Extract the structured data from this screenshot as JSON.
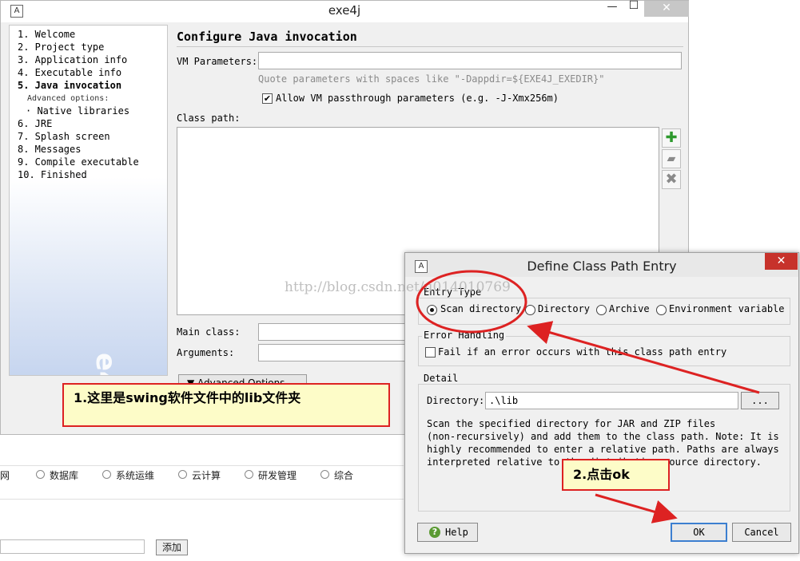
{
  "main_window": {
    "title": "exe4j",
    "icon_glyph": "A",
    "controls": {
      "minimize": "—",
      "maximize": "☐",
      "close": "✕"
    },
    "steps": [
      "1. Welcome",
      "2. Project type",
      "3. Application info",
      "4. Executable info",
      "5. Java invocation",
      "Advanced options:",
      "· Native libraries",
      "6. JRE",
      "7. Splash screen",
      "8. Messages",
      "9. Compile executable",
      "10. Finished"
    ],
    "sidebar_watermark": "e4j",
    "page_title": "Configure Java invocation",
    "vm_parameters_label": "VM Parameters:",
    "vm_parameters_value": "",
    "vm_hint": "Quote parameters with spaces like \"-Dappdir=${EXE4J_EXEDIR}\"",
    "allow_passthrough_label": "Allow VM passthrough parameters (e.g. -J-Xmx256m)",
    "allow_passthrough_checked": true,
    "classpath_label": "Class path:",
    "main_class_label": "Main class:",
    "arguments_label": "Arguments:",
    "advanced_options_label": "▼ Advanced Options",
    "tool_icons": [
      "add-icon",
      "edit-icon",
      "delete-icon"
    ]
  },
  "background_page": {
    "partial_item": "网",
    "radio_options": [
      "数据库",
      "系统运维",
      "云计算",
      "研发管理",
      "综合"
    ],
    "add_button": "添加"
  },
  "annotations": {
    "callout_1": "1.这里是swing软件文件中的lib文件夹",
    "callout_2": "2.点击ok",
    "url_watermark": "http://blog.csdn.net/u014010769",
    "color": "#dd2222"
  },
  "dialog": {
    "title": "Define Class Path Entry",
    "entry_type_title": "Entry Type",
    "entry_types": [
      "Scan directory",
      "Directory",
      "Archive",
      "Environment variable"
    ],
    "selected_entry_type": "Scan directory",
    "error_handling_title": "Error Handling",
    "fail_on_error_label": "Fail if an error occurs with this class path entry",
    "fail_on_error_checked": false,
    "detail_title": "Detail",
    "directory_label": "Directory:",
    "directory_value": ".\\lib",
    "browse_label": "...",
    "description_lines": [
      "Scan the specified directory for JAR and ZIP files",
      "(non-recursively) and add them to the class path. Note: It is",
      "highly recommended to enter a relative path. Paths are always",
      "interpreted relative to the distribution source directory."
    ],
    "help_label": "Help",
    "ok_label": "OK",
    "cancel_label": "Cancel"
  }
}
